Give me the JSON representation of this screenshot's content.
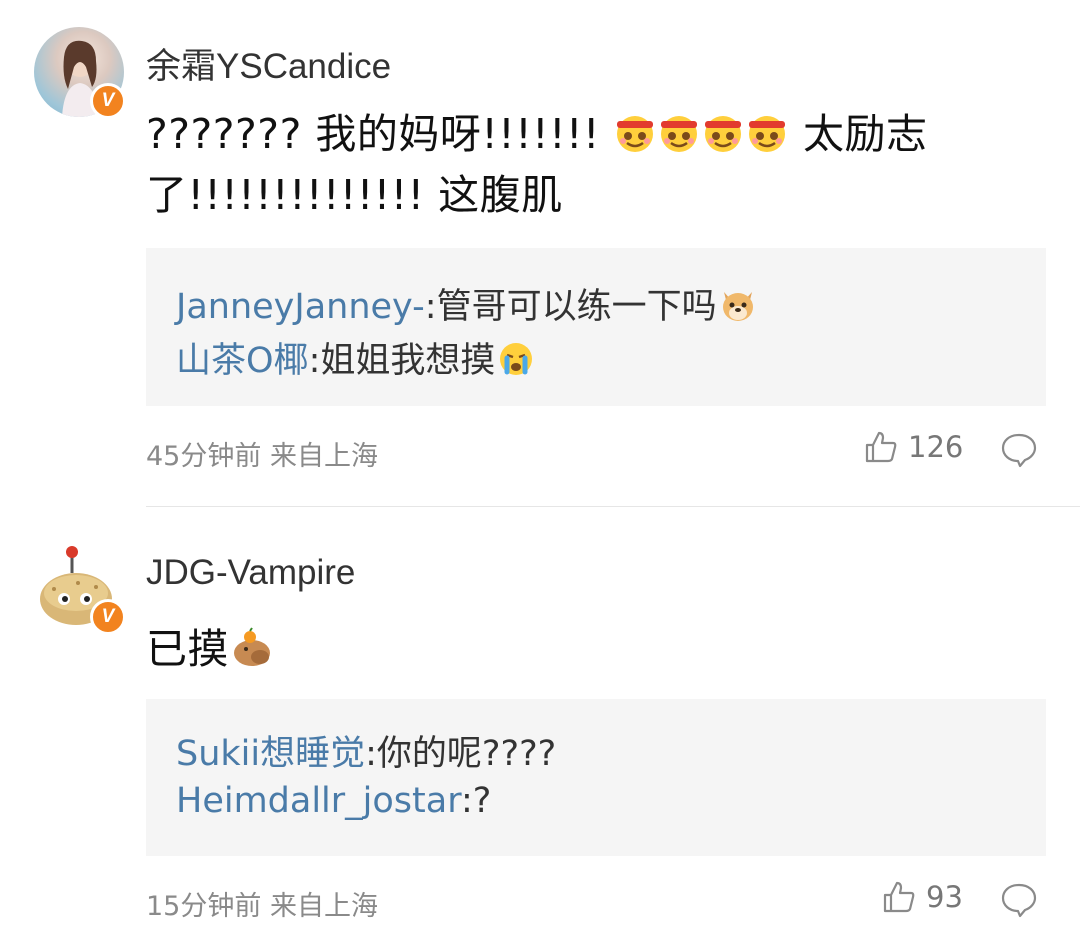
{
  "comments": [
    {
      "username": "余霜YSCandice",
      "verified_badge": "V",
      "content": {
        "part1": "??????? 我的妈呀!!!!!!!",
        "emojis": [
          "headband-smile-emoji",
          "headband-smile-emoji",
          "headband-smile-emoji",
          "headband-smile-emoji"
        ],
        "part2": "太励志了!!!!!!!!!!!!!! 这腹肌"
      },
      "replies": [
        {
          "name": "JanneyJanney-",
          "text": ":管哥可以练一下吗",
          "emoji": "doge-emoji"
        },
        {
          "name": "山茶O椰",
          "text": ":姐姐我想摸",
          "emoji": "crying-emoji"
        }
      ],
      "meta": "45分钟前 来自上海",
      "likes": "126"
    },
    {
      "username": "JDG-Vampire",
      "verified_badge": "V",
      "content": {
        "part1": "已摸",
        "emojis": [
          "capybara-emoji"
        ]
      },
      "replies": [
        {
          "name": "Sukii想睡觉",
          "text": ":你的呢????"
        },
        {
          "name": "Heimdallr_jostar",
          "text": ":?"
        }
      ],
      "meta": "15分钟前 来自上海",
      "likes": "93"
    }
  ],
  "colors": {
    "reply_name": "#4a7ba8",
    "badge": "#f2831f",
    "reply_bg": "#f5f5f5"
  }
}
